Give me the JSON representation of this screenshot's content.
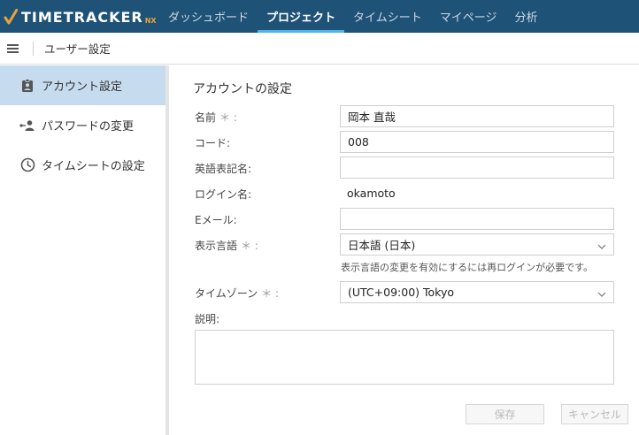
{
  "app": {
    "logo_text": "TIMETRACKER",
    "logo_suffix": "NX"
  },
  "nav": {
    "tabs": [
      {
        "label": "ダッシュボード",
        "active": false
      },
      {
        "label": "プロジェクト",
        "active": true
      },
      {
        "label": "タイムシート",
        "active": false
      },
      {
        "label": "マイページ",
        "active": false
      },
      {
        "label": "分析",
        "active": false
      }
    ]
  },
  "breadcrumb": {
    "title": "ユーザー設定"
  },
  "sidebar": {
    "items": [
      {
        "label": "アカウント設定",
        "icon": "account-badge-icon",
        "active": true
      },
      {
        "label": "パスワードの変更",
        "icon": "key-user-icon",
        "active": false
      },
      {
        "label": "タイムシートの設定",
        "icon": "clock-icon",
        "active": false
      }
    ]
  },
  "form": {
    "title": "アカウントの設定",
    "name_label": "名前",
    "name_value": "岡本 直哉",
    "code_label": "コード:",
    "code_value": "008",
    "english_name_label": "英語表記名:",
    "english_name_value": "",
    "login_label": "ログイン名:",
    "login_value": "okamoto",
    "email_label": "Eメール:",
    "email_value": "",
    "language_label": "表示言語",
    "language_value": "日本語 (日本)",
    "language_hint": "表示言語の変更を有効にするには再ログインが必要です。",
    "timezone_label": "タイムゾーン",
    "timezone_value": "(UTC+09:00) Tokyo",
    "description_label": "説明:",
    "description_value": "",
    "required_mark": "＊ :",
    "name_required_mark": "＊ :"
  },
  "buttons": {
    "save": "保存",
    "cancel": "キャンセル"
  },
  "colors": {
    "topbar": "#1f5277",
    "active_tab_underline": "#4fb3e8",
    "sidebar_active": "#c6dcee",
    "logo_accent": "#e8a33d"
  }
}
